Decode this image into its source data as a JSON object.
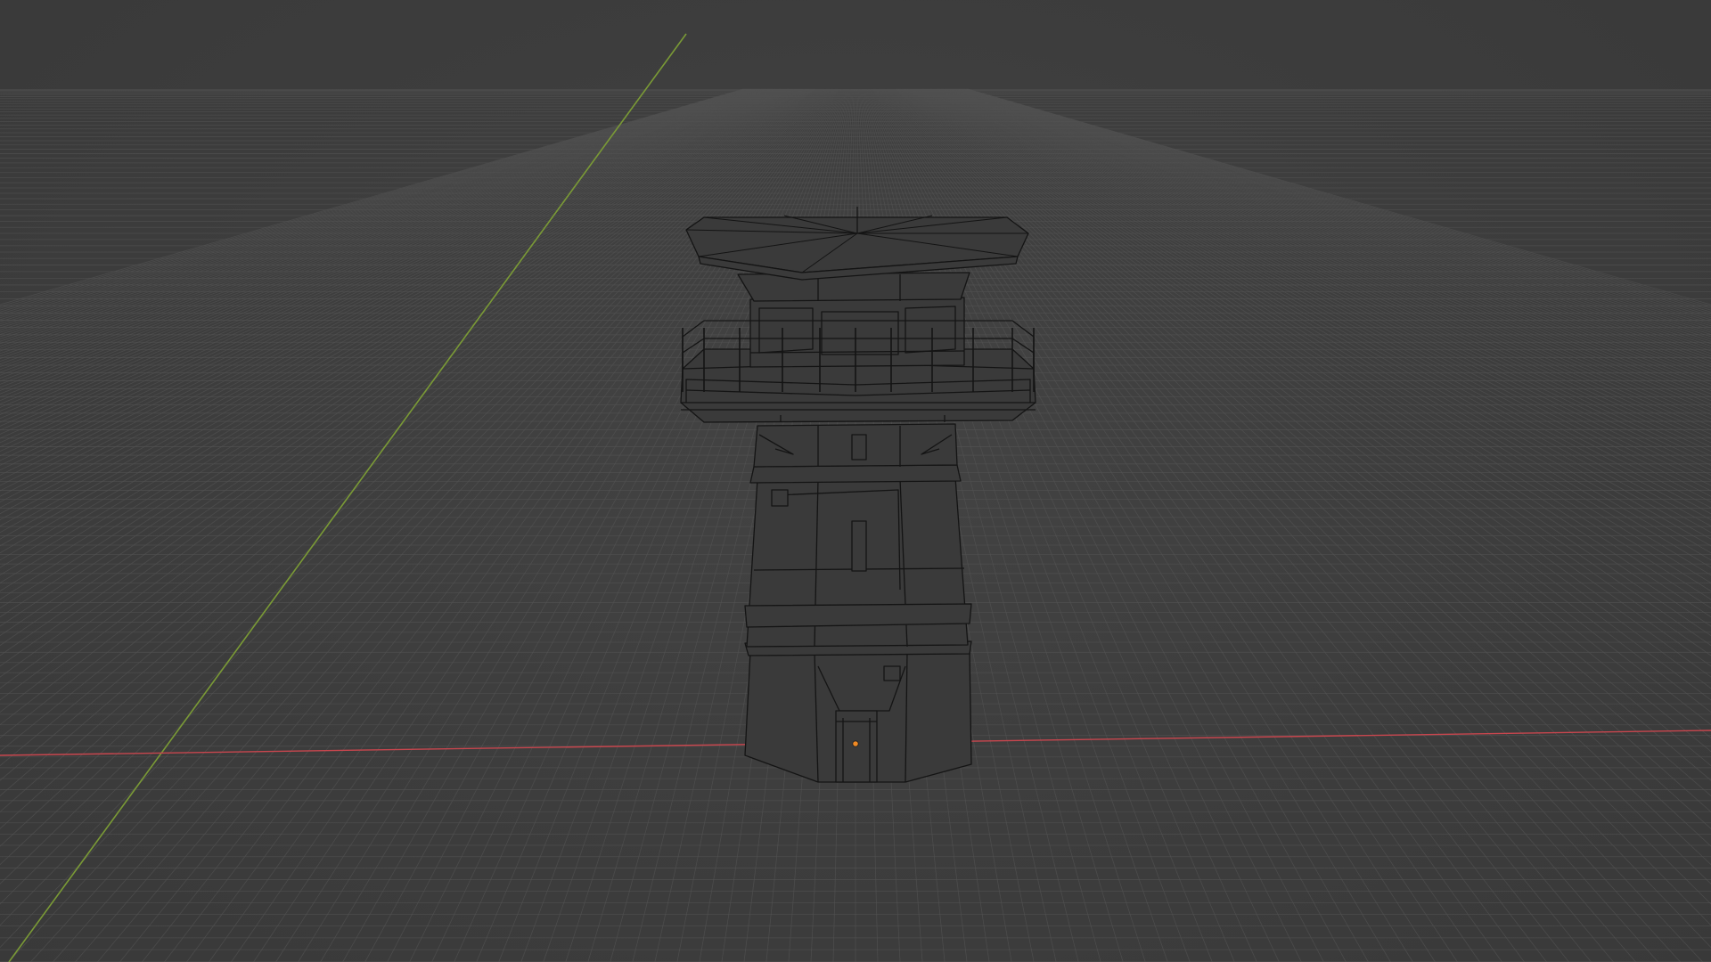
{
  "app": "3D viewport",
  "viewport": {
    "mode": "wireframe",
    "background_color": "#3d3d3d",
    "grid_line_color": "#525252",
    "x_axis_color": "#c8464e",
    "y_axis_color": "#7a9a36",
    "wire_color": "#141414",
    "object_fill": "#3a3a3a",
    "origin_color": "#f08a24"
  },
  "scene": {
    "object": "watchtower",
    "origin_marker": true
  }
}
